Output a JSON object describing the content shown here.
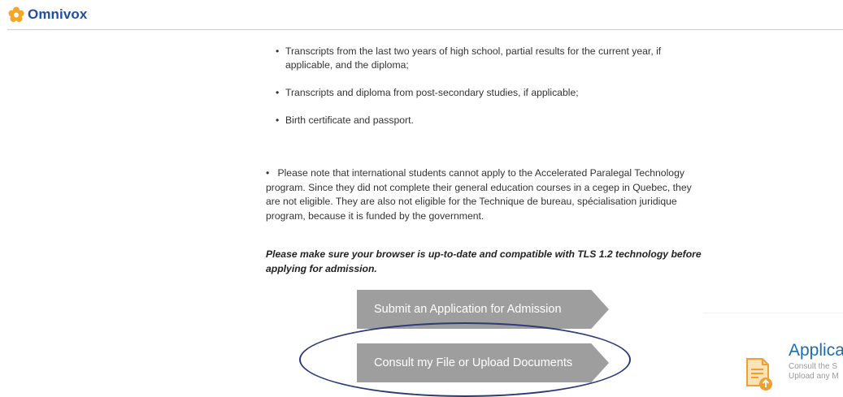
{
  "header": {
    "brand": "Omnivox",
    "logo_icon": "flower-logo-icon",
    "brand_color": "#1f4fa3",
    "logo_color": "#f5a623"
  },
  "documents": {
    "items": [
      "Transcripts from the last two years of high school, partial results for the current year, if applicable, and the diploma;",
      "Transcripts and diploma from post-secondary studies, if applicable;",
      "Birth certificate and passport."
    ]
  },
  "note": "Please note that international students cannot apply to the Accelerated Paralegal Technology program. Since they did not complete their general education courses in a cegep in Quebec, they are not eligible. They are also not eligible for the Technique de bureau, spécialisation juridique program, because it is funded by the government.",
  "tls_notice": "Please make sure your browser is up-to-date and compatible with TLS 1.2 technology before applying for admission.",
  "buttons": {
    "submit": "Submit an Application for Admission",
    "consult": "Consult my File or Upload Documents",
    "color": "#9e9e9e"
  },
  "side_card": {
    "title": "Applica",
    "line1": "Consult the S",
    "line2": "Upload any M",
    "icon": "document-upload-icon",
    "accent": "#f0a030"
  },
  "annotation": {
    "color": "#2b3a78"
  }
}
